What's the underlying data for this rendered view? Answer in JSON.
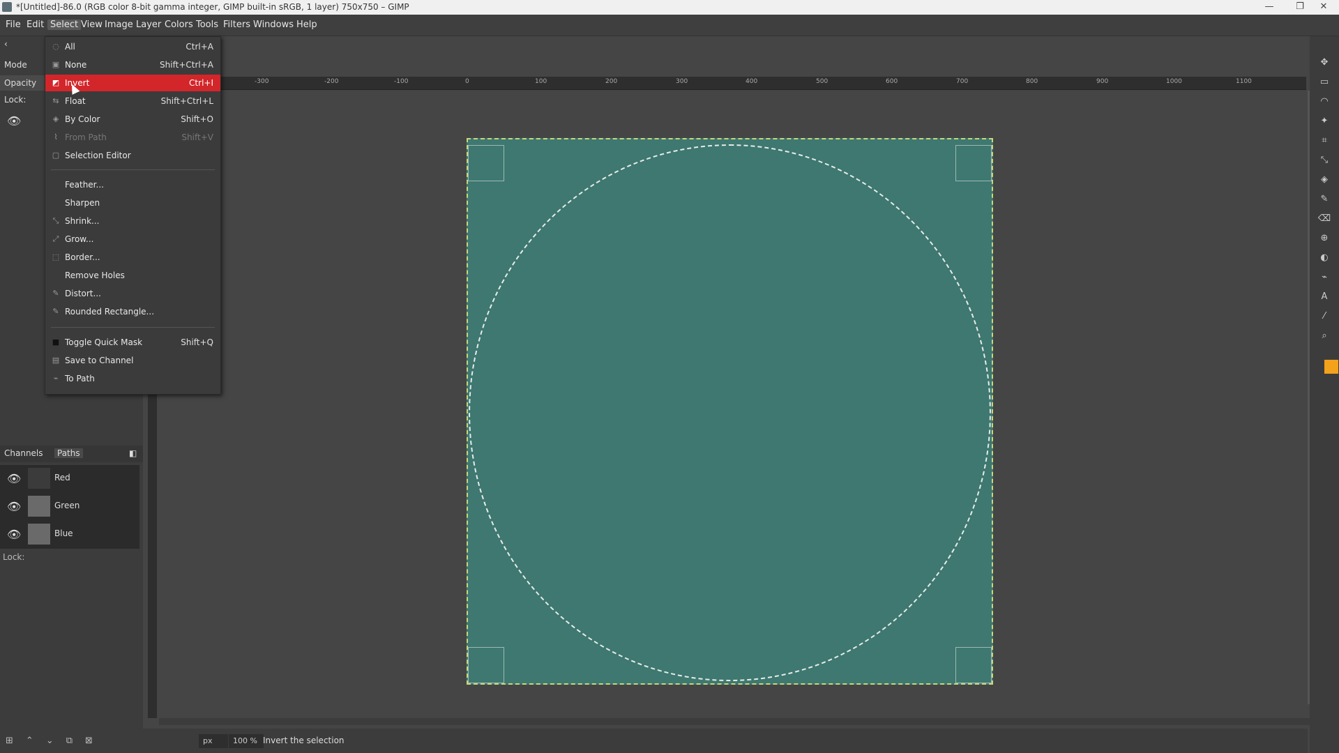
{
  "titlebar": {
    "title": "*[Untitled]-86.0 (RGB color 8-bit gamma integer, GIMP built-in sRGB, 1 layer) 750x750 – GIMP",
    "minimize": "—",
    "restore": "❐",
    "close": "✕"
  },
  "menubar": [
    "File",
    "Edit",
    "Select",
    "View",
    "Image",
    "Layer",
    "Colors",
    "Tools",
    "Filters",
    "Windows",
    "Help"
  ],
  "tool_options": {
    "mode_label": "Mode",
    "opacity_label": "Opacity",
    "lock_label": "Lock:"
  },
  "layers": {
    "eye": "👁"
  },
  "dock_tabs": {
    "channels": "Channels",
    "paths": "Paths"
  },
  "channels": [
    {
      "name": "Red",
      "thumb": "#3b3b3b"
    },
    {
      "name": "Green",
      "thumb": "#6a6a6a"
    },
    {
      "name": "Blue",
      "thumb": "#6a6a6a"
    }
  ],
  "channels_lock_label": "Lock:",
  "hruler_ticks": [
    "-300",
    "-200",
    "-100",
    "0",
    "100",
    "200",
    "300",
    "400",
    "500",
    "600",
    "700",
    "800",
    "900",
    "1000",
    "1100"
  ],
  "statusbar": {
    "unit": "px",
    "zoom": "100 %",
    "message": "Invert the selection"
  },
  "select_menu": [
    {
      "label": "All",
      "shortcut": "Ctrl+A",
      "icon": "◌"
    },
    {
      "label": "None",
      "shortcut": "Shift+Ctrl+A",
      "icon": "▣"
    },
    {
      "label": "Invert",
      "shortcut": "Ctrl+I",
      "icon": "◩",
      "highlighted": true
    },
    {
      "label": "Float",
      "shortcut": "Shift+Ctrl+L",
      "icon": "⇆"
    },
    {
      "label": "By Color",
      "shortcut": "Shift+O",
      "icon": "◈"
    },
    {
      "label": "From Path",
      "shortcut": "Shift+V",
      "icon": "⌇",
      "disabled": true
    },
    {
      "label": "Selection Editor",
      "shortcut": "",
      "icon": "▢"
    },
    {
      "label": "Feather...",
      "shortcut": "",
      "icon": ""
    },
    {
      "label": "Sharpen",
      "shortcut": "",
      "icon": ""
    },
    {
      "label": "Shrink...",
      "shortcut": "",
      "icon": "⤡"
    },
    {
      "label": "Grow...",
      "shortcut": "",
      "icon": "⤢"
    },
    {
      "label": "Border...",
      "shortcut": "",
      "icon": "⬚"
    },
    {
      "label": "Remove Holes",
      "shortcut": "",
      "icon": ""
    },
    {
      "label": "Distort...",
      "shortcut": "",
      "icon": "✎"
    },
    {
      "label": "Rounded Rectangle...",
      "shortcut": "",
      "icon": "✎"
    },
    {
      "label": "Toggle Quick Mask",
      "shortcut": "Shift+Q",
      "icon": "■"
    },
    {
      "label": "Save to Channel",
      "shortcut": "",
      "icon": "▤"
    },
    {
      "label": "To Path",
      "shortcut": "",
      "icon": "⌁"
    }
  ],
  "colors": {
    "menu_highlight": "#d2262a",
    "image_fill": "#3e7870",
    "fg_color": "#f3a21c"
  }
}
